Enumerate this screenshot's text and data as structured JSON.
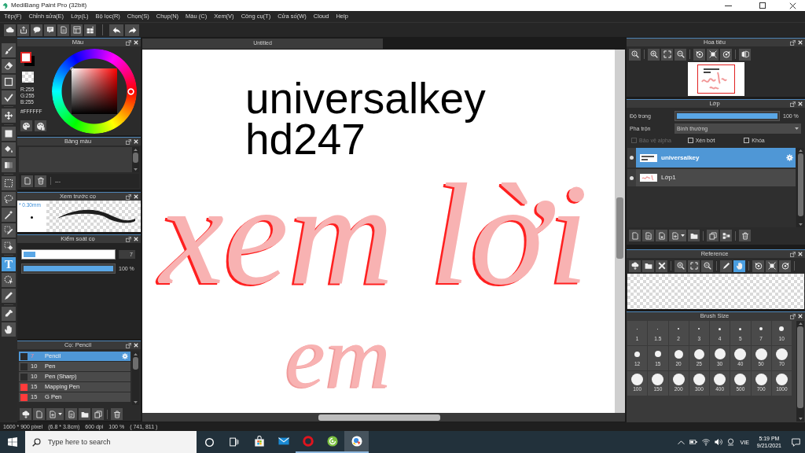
{
  "window": {
    "title": "MediBang Paint Pro (32bit)"
  },
  "menu": [
    "Tệp(F)",
    "Chỉnh sửa(E)",
    "Lớp(L)",
    "Bộ lọc(R)",
    "Chọn(S)",
    "Chụp(N)",
    "Màu (C)",
    "Xem(V)",
    "Công cụ(T)",
    "Cửa số(W)",
    "Cloud",
    "Help"
  ],
  "tools": [
    {
      "selected": false
    },
    {
      "selected": false
    },
    {
      "selected": false
    },
    {
      "selected": false
    },
    {
      "selected": false
    },
    {
      "selected": false
    },
    {
      "selected": false
    },
    {
      "selected": false
    },
    {
      "selected": false
    },
    {
      "selected": false
    },
    {
      "selected": false
    },
    {
      "selected": false
    },
    {
      "selected": false
    },
    {
      "label": "T",
      "selected": true
    },
    {
      "selected": false
    },
    {
      "selected": false
    },
    {
      "selected": false
    },
    {
      "selected": false
    }
  ],
  "color_panel": {
    "title": "Màu",
    "rgb": [
      "R:255",
      "G:255",
      "B:255"
    ],
    "hex": "#FFFFFF"
  },
  "palette_panel": {
    "title": "Bảng màu",
    "label": "---"
  },
  "brush_preview": {
    "title": "Xem trước cọ",
    "size": "* 0.30mm"
  },
  "brush_control": {
    "title": "Kiểm soát cọ",
    "sliders": [
      {
        "kind": "box",
        "level": 0.13,
        "reading": "7"
      },
      {
        "kind": "plain",
        "level": 1,
        "reading": "100 %"
      }
    ]
  },
  "brush_list": {
    "title": "Cọ: Pencil",
    "items": [
      {
        "color": "#2b2b2b",
        "size": "7",
        "name": "Pencil",
        "selected": true
      },
      {
        "color": "#2b2b2b",
        "size": "10",
        "name": "Pen",
        "selected": false
      },
      {
        "color": "#2b2b2b",
        "size": "10",
        "name": "Pen (Sharp)",
        "selected": false
      },
      {
        "color": "#ff3b3b",
        "size": "15",
        "name": "Mapping Pen",
        "selected": false
      },
      {
        "color": "#ff3b3b",
        "size": "15",
        "name": "G Pen",
        "selected": false
      }
    ]
  },
  "document": {
    "tab": "Untitled",
    "text_lines": [
      "universalkey",
      "hd247"
    ],
    "lettering": [
      "xem lời",
      "em"
    ]
  },
  "navigator": {
    "title": "Hoa tiêu"
  },
  "layers": {
    "title": "Lớp",
    "opacity_label": "Độ trong",
    "opacity": {
      "level": 1,
      "reading": "100 %"
    },
    "blend_label": "Pha trộn",
    "blend": "Bình thường",
    "options": [
      {
        "label": "Bảo vệ alpha",
        "checked": false,
        "disabled": true
      },
      {
        "label": "Xén bớt",
        "checked": false,
        "disabled": false
      },
      {
        "label": "Khóa",
        "checked": false,
        "disabled": false
      }
    ],
    "items": [
      {
        "name": "universalkey",
        "selected": true
      },
      {
        "name": "Lớp1",
        "selected": false
      }
    ]
  },
  "reference": {
    "title": "Reference",
    "tools": [
      {
        "selected": false
      },
      {
        "selected": false
      },
      {
        "selected": false
      },
      {
        "selected": false
      },
      {
        "selected": false
      },
      {
        "selected": false
      },
      {
        "selected": false
      },
      {
        "selected": true
      },
      {
        "selected": false
      },
      {
        "selected": false
      },
      {
        "selected": false
      }
    ]
  },
  "brush_size": {
    "title": "Brush Size",
    "sizes": [
      "1",
      "1.5",
      "2",
      "3",
      "4",
      "5",
      "7",
      "10",
      "12",
      "15",
      "20",
      "25",
      "30",
      "40",
      "50",
      "70",
      "100",
      "150",
      "200",
      "300",
      "400",
      "500",
      "700",
      "1000"
    ]
  },
  "status_bar": [
    "1600 * 900 pixel",
    "(6.8 * 3.8cm)",
    "600 dpi",
    "100 %",
    "( 741, 811 )"
  ],
  "taskbar": {
    "search": {
      "placeholder": "Type here to search"
    },
    "apps": [
      {
        "running": false,
        "selected": false
      },
      {
        "running": false,
        "selected": false
      },
      {
        "running": true,
        "selected": false
      },
      {
        "running": true,
        "selected": false
      },
      {
        "running": true,
        "selected": true
      }
    ],
    "language": "VIE",
    "time": "5:19 PM",
    "date": "9/21/2021"
  }
}
